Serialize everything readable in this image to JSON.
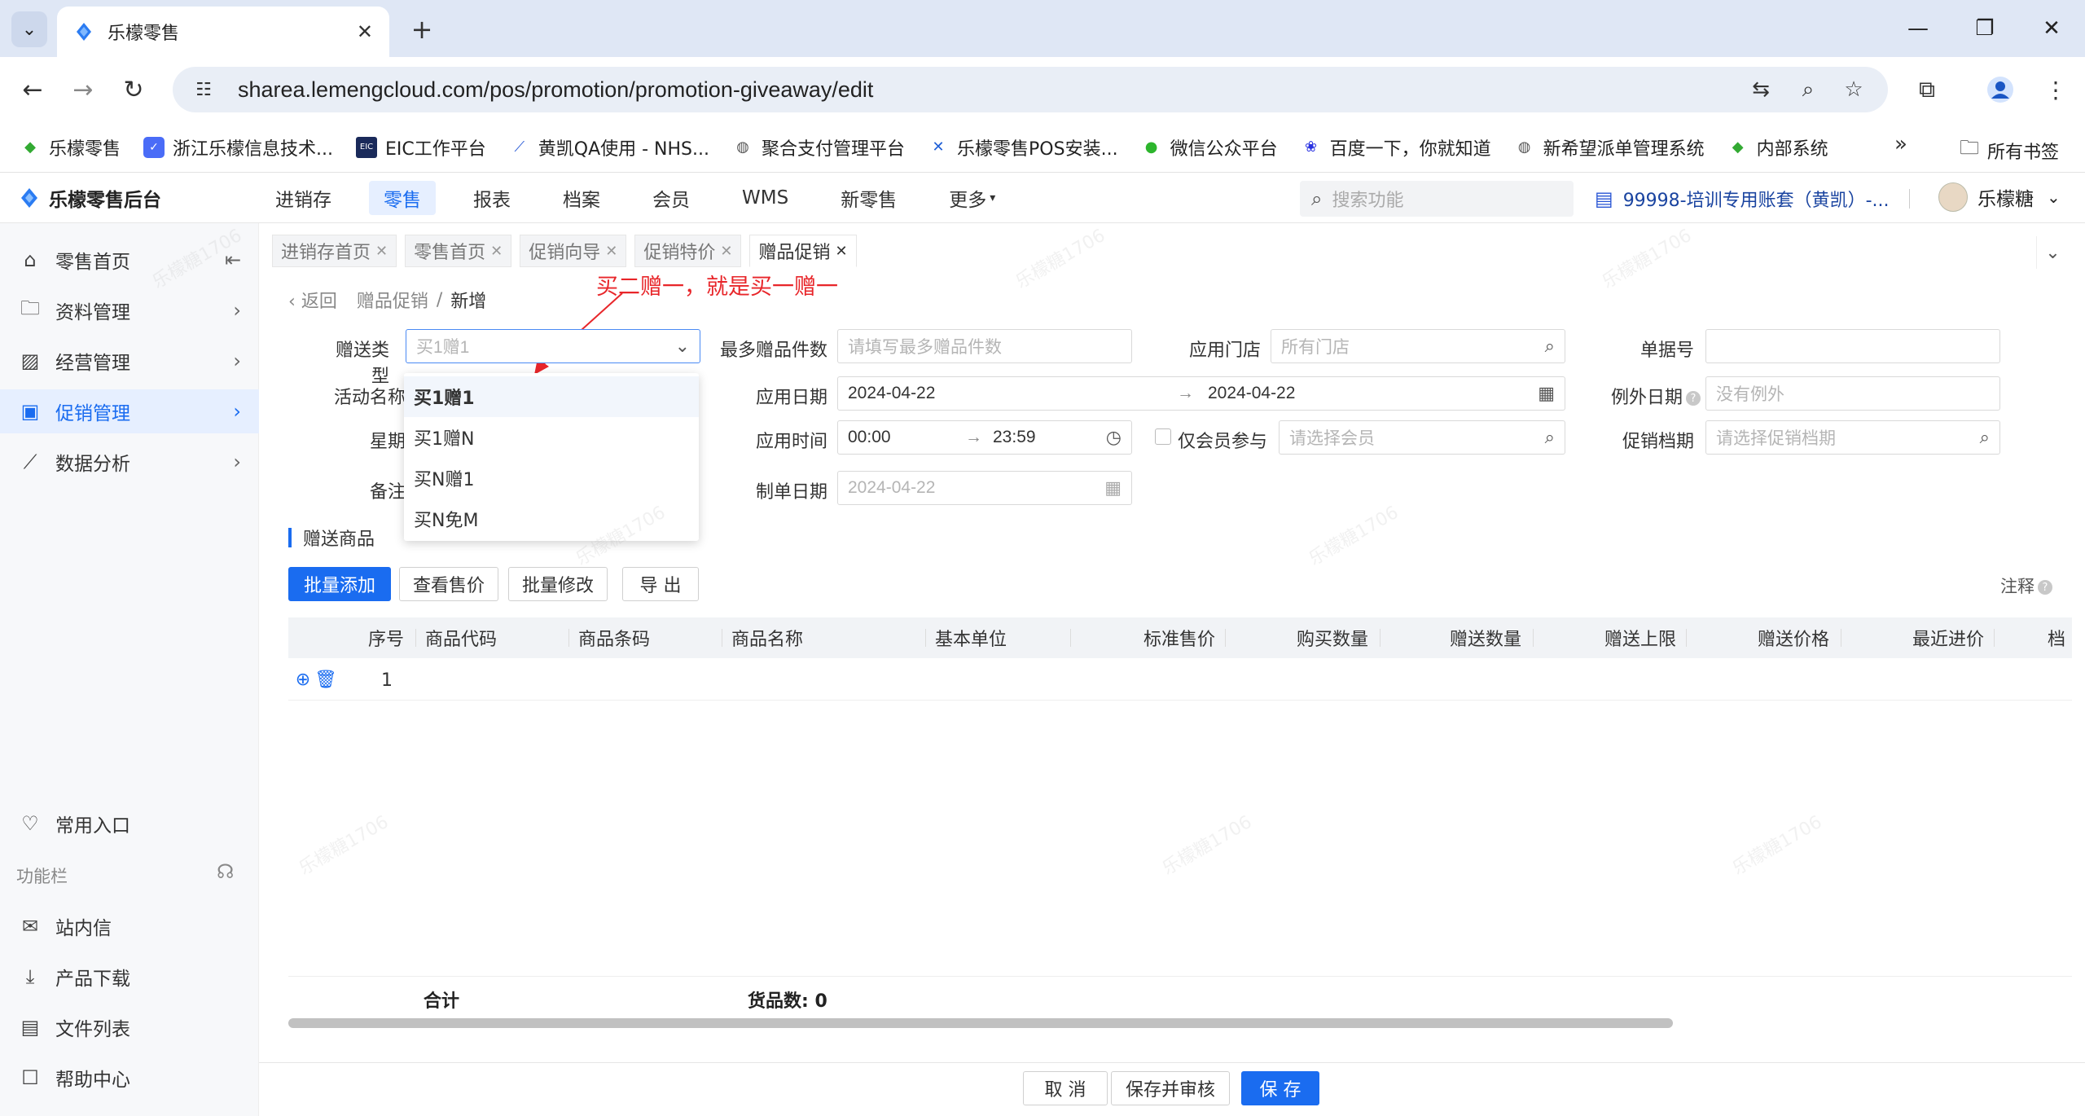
{
  "browser": {
    "tab_title": "乐檬零售",
    "url": "sharea.lemengcloud.com/pos/promotion/promotion-giveaway/edit",
    "bookmarks": [
      {
        "label": "乐檬零售",
        "icon": "lemon-icon"
      },
      {
        "label": "浙江乐檬信息技术...",
        "icon": "company-icon"
      },
      {
        "label": "EIC工作平台",
        "icon": "eic-icon"
      },
      {
        "label": "黄凯QA使用 - NHS...",
        "icon": "jira-icon"
      },
      {
        "label": "聚合支付管理平台",
        "icon": "globe-icon"
      },
      {
        "label": "乐檬零售POS安装...",
        "icon": "confluence-icon"
      },
      {
        "label": "微信公众平台",
        "icon": "wechat-icon"
      },
      {
        "label": "百度一下，你就知道",
        "icon": "baidu-icon"
      },
      {
        "label": "新希望派单管理系统",
        "icon": "globe-icon"
      },
      {
        "label": "内部系统",
        "icon": "lemon-icon"
      }
    ],
    "all_bookmarks": "所有书签"
  },
  "header": {
    "brand": "乐檬零售后台",
    "nav": [
      "进销存",
      "零售",
      "报表",
      "档案",
      "会员",
      "WMS",
      "新零售",
      "更多"
    ],
    "active_nav": "零售",
    "search_placeholder": "搜索功能",
    "account": "99998-培训专用账套（黄凯）-...",
    "user": "乐檬糖"
  },
  "sidebar": {
    "items": [
      "零售首页",
      "资料管理",
      "经营管理",
      "促销管理",
      "数据分析"
    ],
    "active": "促销管理",
    "common_entry": "常用入口",
    "function_bar": "功能栏",
    "bottom_items": [
      "站内信",
      "产品下载",
      "文件列表",
      "帮助中心"
    ]
  },
  "page_tabs": [
    "进销存首页",
    "零售首页",
    "促销向导",
    "促销特价",
    "赠品促销"
  ],
  "breadcrumb": {
    "back": "返回",
    "parent": "赠品促销",
    "current": "新增"
  },
  "annotation": "买二赠一，就是买一赠一",
  "form": {
    "gift_type_label": "赠送类型",
    "gift_type_value": "买1赠1",
    "max_gift_label": "最多赠品件数",
    "max_gift_placeholder": "请填写最多赠品件数",
    "store_label": "应用门店",
    "store_placeholder": "所有门店",
    "doc_no_label": "单据号",
    "activity_label": "活动名称",
    "date_label": "应用日期",
    "date_start": "2024-04-22",
    "date_end": "2024-04-22",
    "exception_label": "例外日期",
    "exception_placeholder": "没有例外",
    "week_label": "星期",
    "time_label": "应用时间",
    "time_start": "00:00",
    "time_end": "23:59",
    "member_only_label": "仅会员参与",
    "member_placeholder": "请选择会员",
    "promo_period_label": "促销档期",
    "promo_period_placeholder": "请选择促销档期",
    "remark_label": "备注",
    "created_label": "制单日期",
    "created_value": "2024-04-22"
  },
  "dropdown_options": [
    "买1赠1",
    "买1赠N",
    "买N赠1",
    "买N免M"
  ],
  "gift_section": {
    "title": "赠送商品",
    "buttons": [
      "批量添加",
      "查看售价",
      "批量修改",
      "导 出"
    ],
    "notes": "注释"
  },
  "table": {
    "columns": [
      "序号",
      "商品代码",
      "商品条码",
      "商品名称",
      "基本单位",
      "标准售价",
      "购买数量",
      "赠送数量",
      "赠送上限",
      "赠送价格",
      "最近进价",
      "档"
    ],
    "rows": [
      {
        "index": "1"
      }
    ],
    "footer_total": "合计",
    "footer_count": "货品数: 0"
  },
  "footer_buttons": {
    "cancel": "取 消",
    "save_audit": "保存并审核",
    "save": "保 存"
  },
  "watermark": "乐檬糖1706",
  "colors": {
    "primary": "#1a6cf0",
    "annotation": "#e8262a"
  }
}
